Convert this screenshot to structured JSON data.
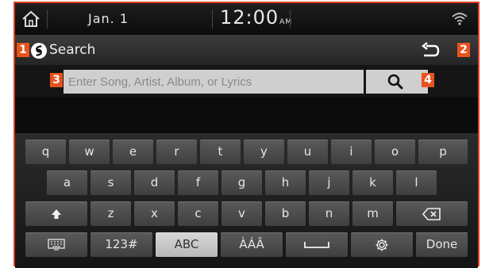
{
  "status_bar": {
    "date": "Jan.  1",
    "time": "12:00",
    "ampm": "AM"
  },
  "title_bar": {
    "title": "Search"
  },
  "search": {
    "placeholder": "Enter Song, Artist, Album, or Lyrics"
  },
  "callouts": {
    "b1": "1",
    "b2": "2",
    "b3": "3",
    "b4": "4"
  },
  "keyboard": {
    "row1": [
      "q",
      "w",
      "e",
      "r",
      "t",
      "y",
      "u",
      "i",
      "o",
      "p"
    ],
    "row2": [
      "a",
      "s",
      "d",
      "f",
      "g",
      "h",
      "j",
      "k",
      "l"
    ],
    "row3": [
      "z",
      "x",
      "c",
      "v",
      "b",
      "n",
      "m"
    ],
    "numbers_label": "123#",
    "abc_label": "ABC",
    "accents_label": "ÀÁÂ",
    "done_label": "Done"
  },
  "icons": {
    "home": "home-icon",
    "wifi": "wifi-icon",
    "app": "shazam-icon",
    "back": "back-icon",
    "search": "search-icon",
    "shift": "shift-icon",
    "backspace": "backspace-icon",
    "keyboard": "keyboard-icon",
    "space": "space-icon",
    "settings": "settings-icon"
  },
  "colors": {
    "callout": "#e8531d",
    "frame": "#e23b24"
  }
}
